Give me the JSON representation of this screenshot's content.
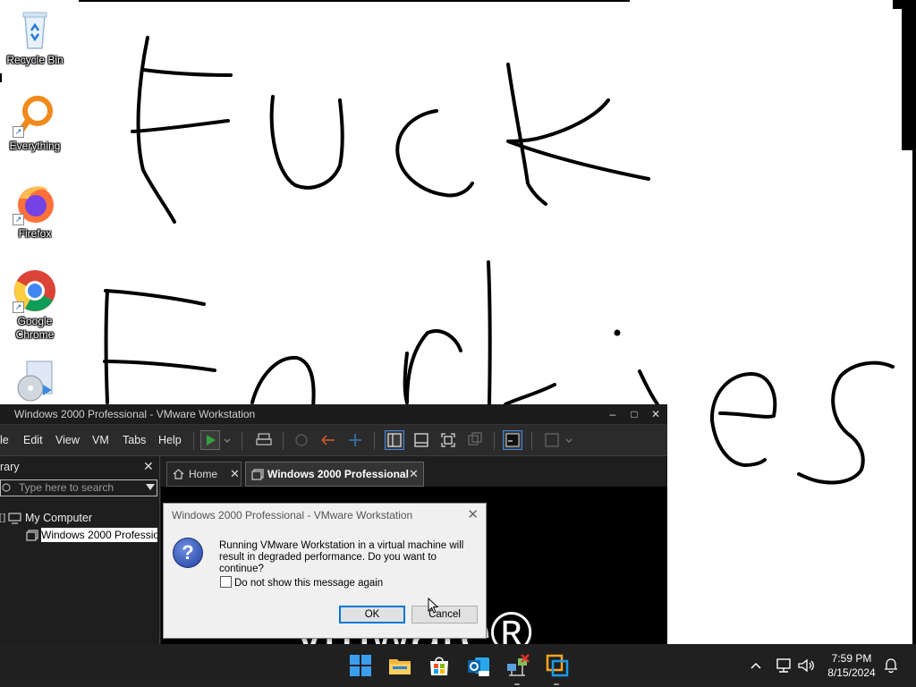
{
  "desktop": {
    "icons": [
      {
        "label": "Recycle Bin",
        "icon": "recycle-bin-icon"
      },
      {
        "label": "Everything",
        "icon": "everything-search-icon"
      },
      {
        "label": "Firefox",
        "icon": "firefox-icon"
      },
      {
        "label": "Google Chrome",
        "icon": "chrome-icon"
      },
      {
        "label": "",
        "icon": "installer-disc-icon"
      }
    ],
    "wallpaper": "white background with black hand-drawn scribble strokes"
  },
  "vmware": {
    "title": "Windows 2000 Professional - VMware Workstation",
    "menu": [
      "le",
      "Edit",
      "View",
      "VM",
      "Tabs",
      "Help"
    ],
    "library": {
      "header": "rary",
      "search_placeholder": "Type here to search",
      "tree": {
        "root": "My Computer",
        "child": "Windows 2000 Professio"
      }
    },
    "tabs": [
      {
        "label": "Home"
      },
      {
        "label": "Windows 2000 Professional"
      }
    ],
    "brand_text": "vmware®"
  },
  "dialog": {
    "title": "Windows 2000 Professional - VMware Workstation",
    "message": "Running VMware Workstation in a virtual machine will result in degraded performance. Do you want to continue?",
    "checkbox_label": "Do not show this message again",
    "ok": "OK",
    "cancel": "Cancel"
  },
  "taskbar": {
    "apps": [
      "windows-start-icon",
      "file-explorer-icon",
      "microsoft-store-icon",
      "outlook-new-icon",
      "network-tool-icon",
      "vmware-workstation-icon"
    ],
    "time": "7:59 PM",
    "date": "8/15/2024"
  },
  "colors": {
    "taskbar": "#202020",
    "accent": "#0078d7",
    "vmware_dark": "#202020"
  }
}
